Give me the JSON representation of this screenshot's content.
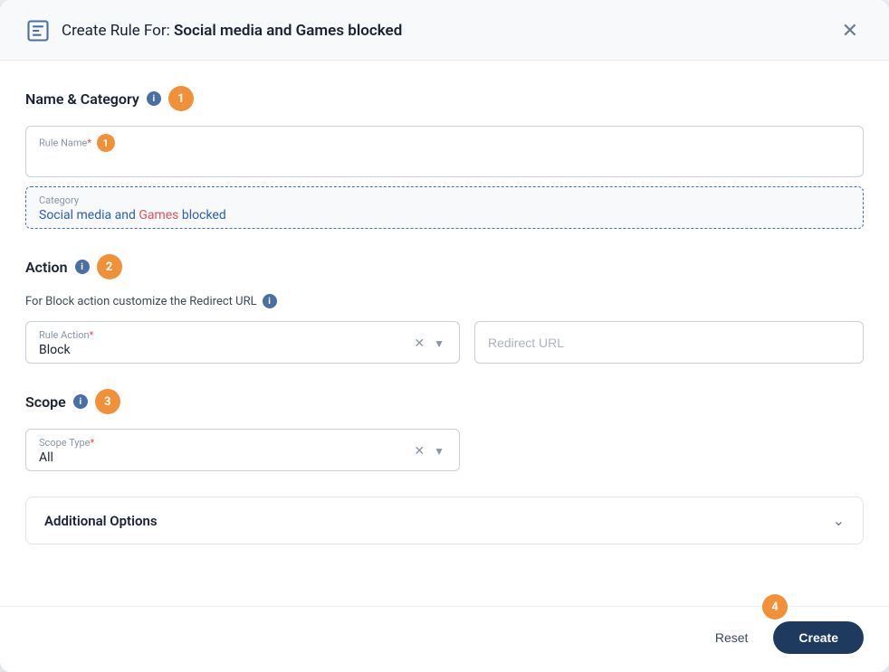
{
  "header": {
    "icon": "rule-icon",
    "title_prefix": "Create Rule For: ",
    "title_bold": "Social media and Games blocked",
    "close_label": "✕"
  },
  "sections": {
    "name_category": {
      "title": "Name & Category",
      "step": "1",
      "rule_name_label": "Rule Name",
      "rule_name_required": "*",
      "rule_name_placeholder": "",
      "category_label": "Category",
      "category_value_prefix": "Social media and ",
      "category_value_highlight": "Games",
      "category_value_suffix": " blocked"
    },
    "action": {
      "title": "Action",
      "step": "2",
      "hint": "For Block action customize the Redirect URL",
      "rule_action_label": "Rule Action",
      "rule_action_required": "*",
      "rule_action_value": "Block",
      "redirect_url_placeholder": "Redirect URL"
    },
    "scope": {
      "title": "Scope",
      "step": "3",
      "scope_type_label": "Scope Type",
      "scope_type_required": "*",
      "scope_type_value": "All"
    },
    "additional_options": {
      "title": "Additional Options"
    }
  },
  "footer": {
    "step": "4",
    "reset_label": "Reset",
    "create_label": "Create"
  }
}
